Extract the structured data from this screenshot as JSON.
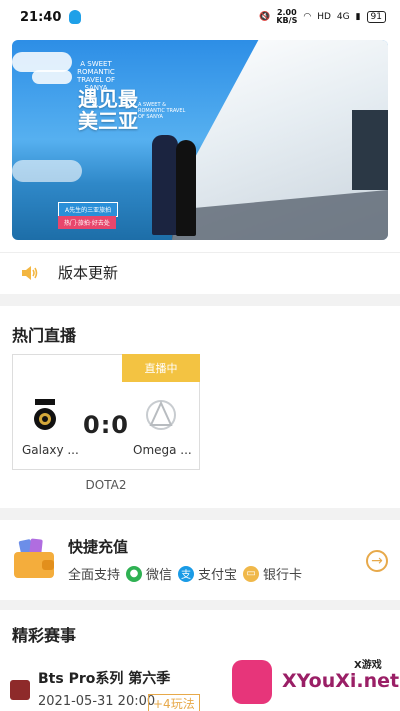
{
  "status_bar": {
    "time": "21:40",
    "speed_value": "2.00",
    "speed_unit": "KB/S",
    "network": "HD",
    "signal": "4G",
    "battery": "91"
  },
  "banner": {
    "title": "遇见最美三亚",
    "small_text": "A SWEET ROMANTIC TRAVEL OF SANYA",
    "sub_text": "A SWEET & ROMANTIC TRAVEL OF SANYA",
    "tag1": "A先生的三亚旅拍",
    "tag2": "热门·旅拍·好去处"
  },
  "notice": {
    "icon": "speaker-icon",
    "text": "版本更新"
  },
  "live": {
    "section_title": "热门直播",
    "badge": "直播中",
    "score": "0:0",
    "team_left": "Galaxy ...",
    "team_right": "Omega ...",
    "game": "DOTA2"
  },
  "recharge": {
    "title": "快捷充值",
    "support_label": "全面支持",
    "methods": [
      {
        "label": "微信",
        "icon": "wechat-icon",
        "color": "#2fb153"
      },
      {
        "label": "支付宝",
        "icon": "alipay-icon",
        "color": "#1a9be6"
      },
      {
        "label": "银行卡",
        "icon": "bankcard-icon",
        "color": "#f0b84a"
      }
    ],
    "arrow_icon": "arrow-right-icon"
  },
  "events": {
    "section_title": "精彩赛事",
    "event_name": "Bts Pro系列 第六季",
    "event_time": "2021-05-31 20:00",
    "event_tag": "+4玩法"
  },
  "watermark": {
    "text": "XYouXi.net",
    "small": "X游戏"
  },
  "colors": {
    "accent": "#f3c342",
    "arrow": "#e7a94a",
    "background": "#f2f2f2"
  }
}
